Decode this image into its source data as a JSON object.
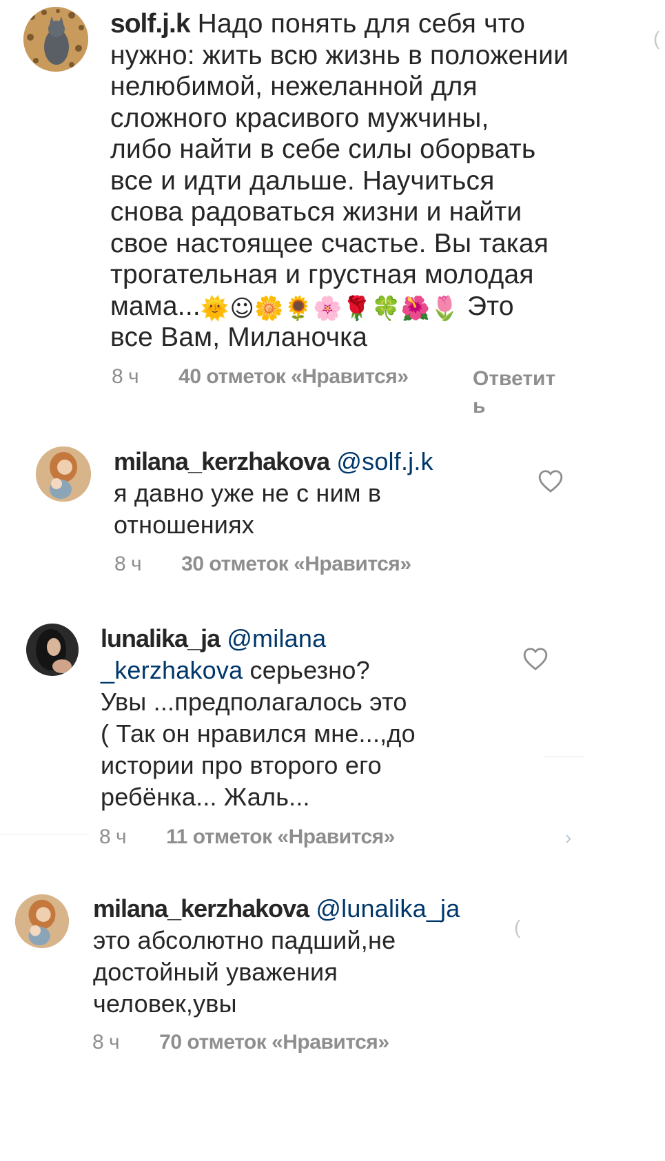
{
  "comments": [
    {
      "username": "solf.j.k",
      "mention": "",
      "text_lines": [
        "Надо понять для себя что",
        "нужно: жить всю жизнь в положении",
        "нелюбимой, нежеланной для",
        "сложного красивого мужчины,",
        "либо найти в себе силы оборвать",
        "все и идти дальше. Научиться",
        "снова радоваться жизни и найти",
        "свое настоящее счастье. Вы такая",
        "трогательная и грустная молодая"
      ],
      "line9_prefix": "мама...",
      "emojis": [
        "🌞",
        "☺",
        "🌼",
        "🌻",
        "🌸",
        "🌹",
        "🍀",
        "🌺",
        "🌷"
      ],
      "line9_suffix": "Это",
      "line10": "все Вам, Миланочка",
      "time": "8 ч",
      "likes": "40 отметок «Нравится»",
      "reply": "Ответить"
    },
    {
      "username": "milana_kerzhakova",
      "mention": "@solf.j.k",
      "text_lines": [
        "я давно уже не с ним в",
        "отношениях"
      ],
      "time": "8 ч",
      "likes": "30 отметок «Нравится»"
    },
    {
      "username": "lunalika_ja",
      "mention_part1": "@milana",
      "mention_part2": "_kerzhakova",
      "after_mention": "серьезно?",
      "text_lines": [
        "Увы ...предполагалось это",
        "( Так он нравился мне...,до",
        "истории про второго его",
        "ребёнка... Жаль..."
      ],
      "time": "8 ч",
      "likes": "11 отметок «Нравится»"
    },
    {
      "username": "milana_kerzhakova",
      "mention": "@lunalika_ja",
      "text_lines": [
        "это абсолютно падший,не",
        "достойный уважения",
        "человек,увы"
      ],
      "time": "8 ч",
      "likes": "70 отметок «Нравится»"
    }
  ],
  "colors": {
    "text": "#262626",
    "mention": "#00376b",
    "meta": "#8e8e8e"
  },
  "icons": [
    "heart-outline-icon"
  ]
}
